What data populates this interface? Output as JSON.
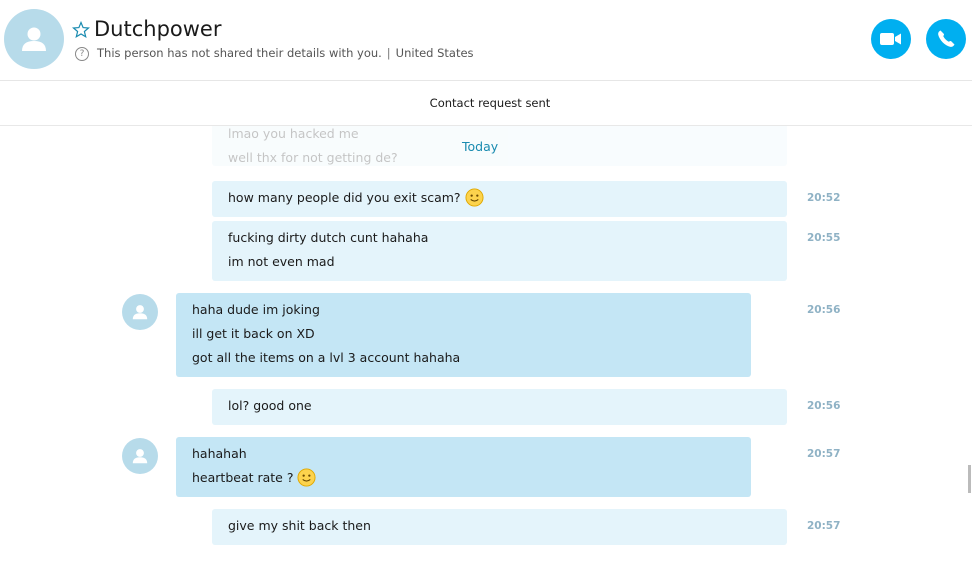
{
  "header": {
    "contact_name": "Dutchpower",
    "privacy_note": "This person has not shared their details with you.",
    "location": "United States",
    "separator": "|",
    "video_call_icon": "video-camera-icon",
    "audio_call_icon": "phone-icon"
  },
  "notice": {
    "text": "Contact request sent"
  },
  "chat": {
    "date_divider": "Today",
    "faded_lines": [
      "lmao you hacked me",
      "well thx for not getting de?"
    ],
    "messages": [
      {
        "direction": "outgoing",
        "lines": [
          "how many people did you exit scam?"
        ],
        "emoji": "smile",
        "time": "20:52"
      },
      {
        "direction": "outgoing",
        "lines": [
          "fucking dirty dutch cunt hahaha",
          "im not even mad"
        ],
        "time": "20:55"
      },
      {
        "direction": "incoming",
        "lines": [
          "haha dude im joking",
          "ill get it back on XD",
          "got all the items on a lvl 3 account hahaha"
        ],
        "time": "20:56"
      },
      {
        "direction": "outgoing",
        "lines": [
          "lol? good one"
        ],
        "time": "20:56"
      },
      {
        "direction": "incoming",
        "lines": [
          "hahahah",
          "heartbeat rate ?"
        ],
        "emoji": "smile",
        "time": "20:57"
      },
      {
        "direction": "outgoing",
        "lines": [
          "give my shit back then"
        ],
        "time": "20:57"
      }
    ]
  },
  "colors": {
    "accent": "#00aff0",
    "incoming_bubble": "#c4e6f5",
    "outgoing_bubble": "#e4f4fb",
    "avatar": "#b7dbea"
  }
}
